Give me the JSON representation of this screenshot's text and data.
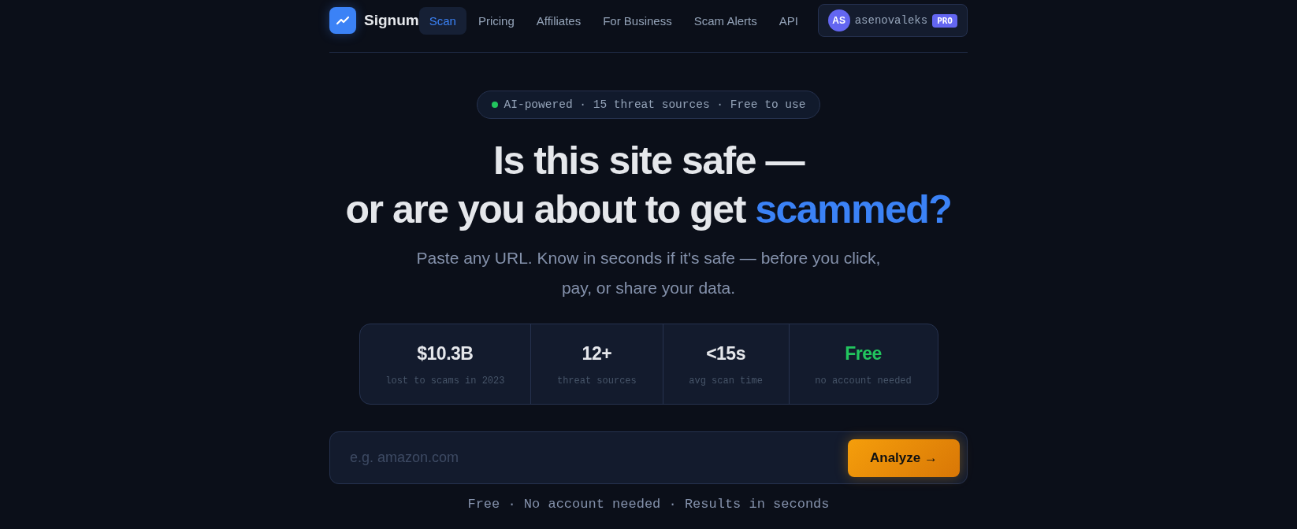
{
  "brand": {
    "name": "Signum"
  },
  "nav": [
    {
      "label": "Scan",
      "selected": true
    },
    {
      "label": "Pricing",
      "selected": false
    },
    {
      "label": "Affiliates",
      "selected": false
    },
    {
      "label": "For Business",
      "selected": false
    },
    {
      "label": "Scam Alerts",
      "selected": false
    },
    {
      "label": "API",
      "selected": false
    }
  ],
  "user": {
    "initials": "AS",
    "name": "asenovaleks",
    "badge": "PRO"
  },
  "tagline": {
    "text": "AI-powered · 15 threat sources · Free to use",
    "live": true
  },
  "heading": [
    {
      "text": "Is this site safe —"
    },
    {
      "text": "or are you about to get ",
      "highlight": "scammed?"
    }
  ],
  "subtitle": "Paste any URL. Know in seconds if it's safe — before you click, pay, or share your data.",
  "stats": [
    {
      "value": "$10.3B",
      "label": "lost to scams in 2023",
      "color": "#e5e7eb"
    },
    {
      "value": "12+",
      "label": "threat sources",
      "color": "#e5e7eb"
    },
    {
      "value": "<15s",
      "label": "avg scan time",
      "color": "#e5e7eb"
    },
    {
      "value": "Free",
      "label": "no account needed",
      "color": "#22c55e"
    }
  ],
  "search": {
    "placeholder": "e.g. amazon.com",
    "button": "Analyze →"
  },
  "footnote": "Free · No account needed · Results in seconds"
}
